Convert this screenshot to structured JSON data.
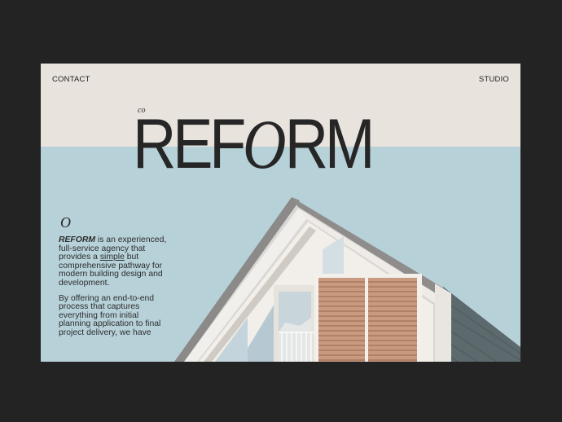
{
  "nav": {
    "contact_label": "CONTACT",
    "studio_label": "STUDIO"
  },
  "logo": {
    "prefix": "co",
    "part1": "REF",
    "part2": "O",
    "part3": "RM"
  },
  "intro": {
    "mark": "O",
    "p1_brand": "REFORM",
    "p1_a": " is an experienced, full-service agency that provides a ",
    "p1_link": "simple",
    "p1_b": " but comprehensive pathway for modern building design and development.",
    "p2": "By offering an end-to-end process that captures everything from initial planning application to final project delivery, we have"
  },
  "colors": {
    "page_background": "#232323",
    "header_band": "#e8e3dd",
    "sky": "#b7d1d9",
    "text": "#262626"
  },
  "image": {
    "icon": "house-photo"
  }
}
